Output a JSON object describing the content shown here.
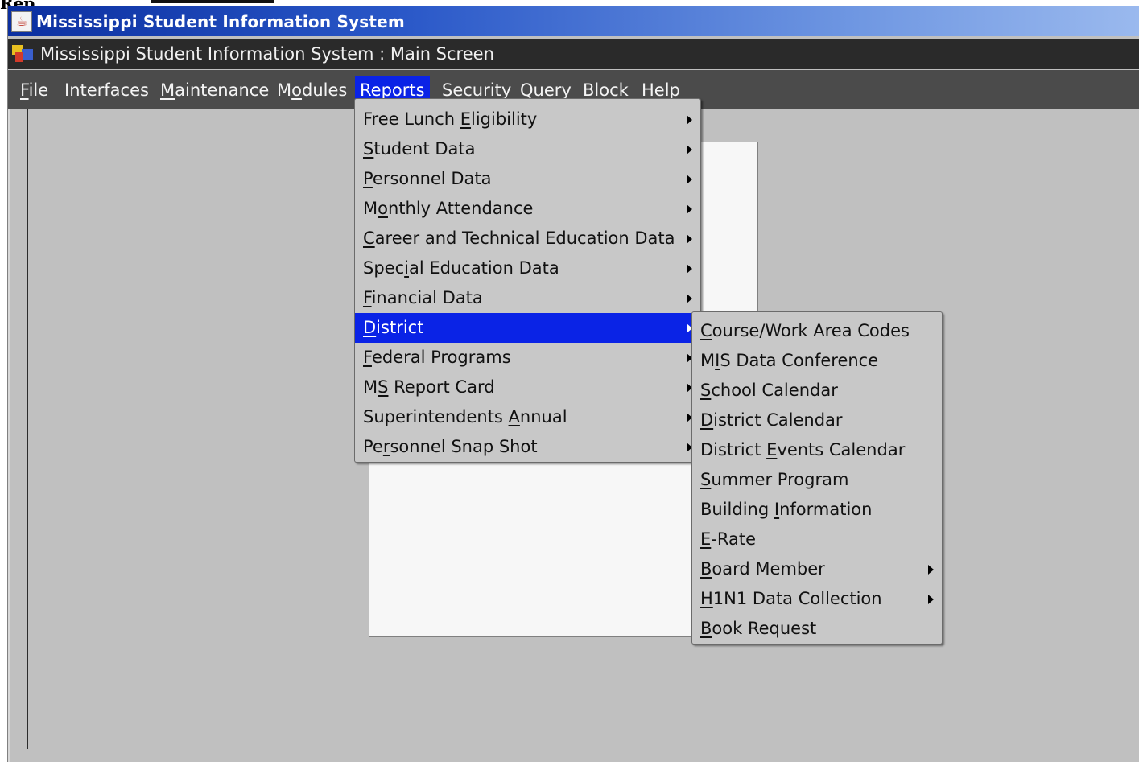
{
  "page_top": {
    "cropped_text": "Rep"
  },
  "window": {
    "title": "Mississippi Student Information System"
  },
  "inner": {
    "title": "Mississippi Student Information System : Main Screen"
  },
  "menubar": {
    "items": [
      {
        "label": "File",
        "ul": "F"
      },
      {
        "label": "Interfaces",
        "ul": ""
      },
      {
        "label": "Maintenance",
        "ul": "M"
      },
      {
        "label": "Modules",
        "ul": "o"
      },
      {
        "label": "Reports",
        "ul": "R"
      },
      {
        "label": "Security",
        "ul": "S"
      },
      {
        "label": "Query",
        "ul": "Q"
      },
      {
        "label": "Block",
        "ul": "B"
      },
      {
        "label": "Help",
        "ul": "H"
      }
    ],
    "active": "Reports"
  },
  "reports_menu": {
    "items": [
      {
        "pre": "Free Lunch ",
        "ul": "E",
        "post": "ligibility",
        "submenu": true
      },
      {
        "pre": "",
        "ul": "S",
        "post": "tudent Data",
        "submenu": true
      },
      {
        "pre": "",
        "ul": "P",
        "post": "ersonnel Data",
        "submenu": true
      },
      {
        "pre": "M",
        "ul": "o",
        "post": "nthly Attendance",
        "submenu": true
      },
      {
        "pre": "",
        "ul": "C",
        "post": "areer and Technical Education Data",
        "submenu": true
      },
      {
        "pre": "Spec",
        "ul": "i",
        "post": "al Education Data",
        "submenu": true
      },
      {
        "pre": "",
        "ul": "F",
        "post": "inancial Data",
        "submenu": true
      },
      {
        "pre": "",
        "ul": "D",
        "post": "istrict",
        "submenu": true,
        "selected": true
      },
      {
        "pre": "",
        "ul": "F",
        "post": "ederal Programs",
        "submenu": true
      },
      {
        "pre": "M",
        "ul": "S",
        "post": " Report Card",
        "submenu": true
      },
      {
        "pre": "Superintendents ",
        "ul": "A",
        "post": "nnual",
        "submenu": true
      },
      {
        "pre": "Pe",
        "ul": "r",
        "post": "sonnel Snap Shot",
        "submenu": true
      }
    ]
  },
  "district_menu": {
    "items": [
      {
        "pre": "",
        "ul": "C",
        "post": "ourse/Work Area Codes",
        "submenu": false
      },
      {
        "pre": "M",
        "ul": "I",
        "post": "S Data Conference",
        "submenu": false
      },
      {
        "pre": "",
        "ul": "S",
        "post": "chool Calendar",
        "submenu": false
      },
      {
        "pre": "",
        "ul": "D",
        "post": "istrict Calendar",
        "submenu": false
      },
      {
        "pre": "District ",
        "ul": "E",
        "post": "vents Calendar",
        "submenu": false
      },
      {
        "pre": "",
        "ul": "S",
        "post": "ummer Program",
        "submenu": false
      },
      {
        "pre": "Building ",
        "ul": "I",
        "post": "nformation",
        "submenu": false
      },
      {
        "pre": "",
        "ul": "E",
        "post": "-Rate",
        "submenu": false
      },
      {
        "pre": "",
        "ul": "B",
        "post": "oard Member",
        "submenu": true
      },
      {
        "pre": "",
        "ul": "H",
        "post": "1N1 Data Collection",
        "submenu": true
      },
      {
        "pre": "",
        "ul": "B",
        "post": "ook Request",
        "submenu": false
      }
    ]
  },
  "colors": {
    "highlight": "#0a23e6",
    "menu_bg": "#c8c8c8",
    "title_gradient_start": "#0b2fa0"
  },
  "icons": {
    "window": "java-cup-icon",
    "frame": "app-frame-icon",
    "submenu": "submenu-arrow-icon"
  }
}
